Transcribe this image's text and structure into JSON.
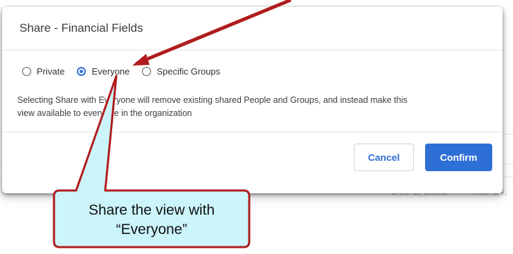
{
  "background": {
    "date_left": "Dec 1, 2022",
    "date_right": "Mar 14,"
  },
  "dialog": {
    "title": "Share - Financial Fields",
    "options": [
      {
        "label": "Private",
        "selected": false
      },
      {
        "label": "Everyone",
        "selected": true
      },
      {
        "label": "Specific Groups",
        "selected": false
      }
    ],
    "info_line1": "Selecting Share with Everyone will remove existing shared People and Groups, and instead make this",
    "info_line2": "view available to everyone in the organization",
    "cancel_label": "Cancel",
    "confirm_label": "Confirm"
  },
  "callout": {
    "line1": "Share the view with",
    "line2": "“Everyone”",
    "fill_color": "#ccf5fb",
    "border_color": "#b01c1c",
    "arrow_color": "#b01c1c"
  },
  "colors": {
    "accent": "#2e6fd6"
  }
}
